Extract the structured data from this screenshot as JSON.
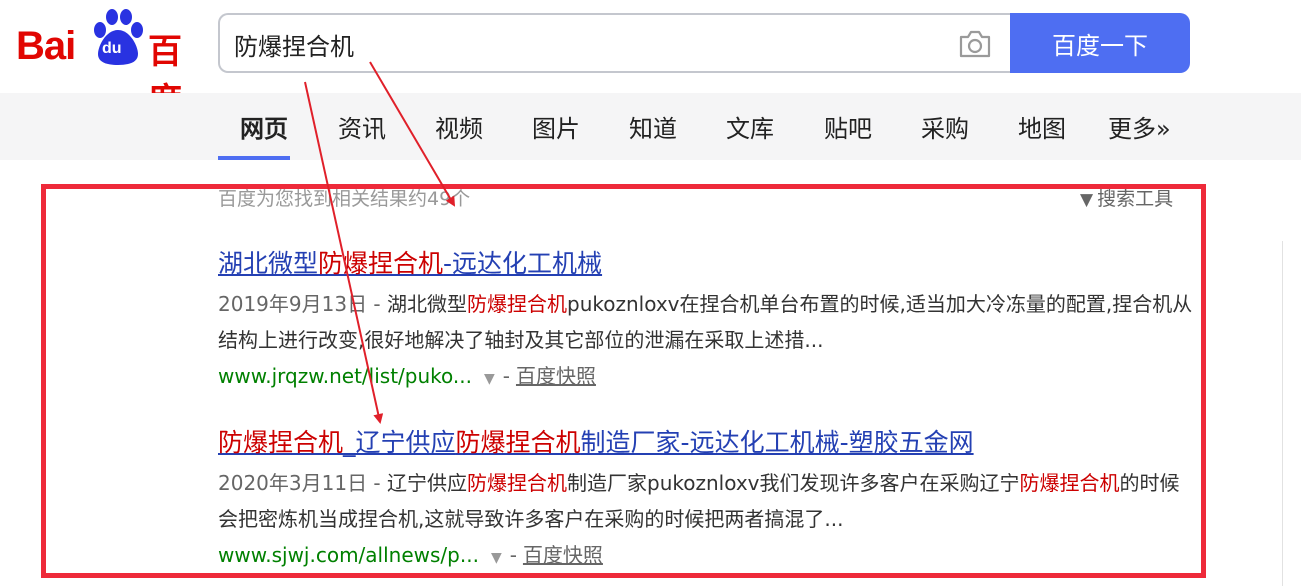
{
  "header": {
    "logo_text_latin": "Bai",
    "logo_text_du": "du",
    "logo_text_cn": "百度",
    "search_value": "防爆捏合机",
    "search_button": "百度一下",
    "camera_icon": "camera-icon",
    "brand_blue": "#4e6ef2",
    "brand_red": "#e10602"
  },
  "nav": {
    "tabs": [
      {
        "label": "网页",
        "active": true
      },
      {
        "label": "资讯"
      },
      {
        "label": "视频"
      },
      {
        "label": "图片"
      },
      {
        "label": "知道"
      },
      {
        "label": "文库"
      },
      {
        "label": "贴吧"
      },
      {
        "label": "采购"
      },
      {
        "label": "地图"
      },
      {
        "label": "更多»"
      }
    ]
  },
  "results_meta": {
    "count_text": "百度为您找到相关结果约49个",
    "tools_label": "搜索工具",
    "filter_icon": "funnel-icon"
  },
  "results": [
    {
      "title_parts": [
        "湖北微型",
        "防爆捏合机",
        "-远达化工机械"
      ],
      "date": "2019年9月13日 - ",
      "abstract_parts": [
        "湖北微型",
        "防爆捏合机",
        "pukoznloxv在捏合机单台布置的时候,适当加大冷冻量的配置,捏合机从结构上进行改变,很好地解决了轴封及其它部位的泄漏在采取上述措..."
      ],
      "url": "www.jrqzw.net/list/puko...",
      "separator": "-",
      "snapshot": "百度快照"
    },
    {
      "title_parts": [
        "防爆捏合机",
        "_辽宁供应",
        "防爆捏合机",
        "制造厂家-远达化工机械-塑胶五金网"
      ],
      "date": "2020年3月11日 - ",
      "abstract_parts": [
        "辽宁供应",
        "防爆捏合机",
        "制造厂家pukoznloxv我们发现许多客户在采购辽宁",
        "防爆捏合机",
        "的时候会把密炼机当成捏合机,这就导致许多客户在采购的时候把两者搞混了..."
      ],
      "url": "www.sjwj.com/allnews/p...",
      "separator": "-",
      "snapshot": "百度快照"
    }
  ],
  "annotation": {
    "frame_color": "#ee2a3a",
    "arrow_color": "#e0202a"
  }
}
